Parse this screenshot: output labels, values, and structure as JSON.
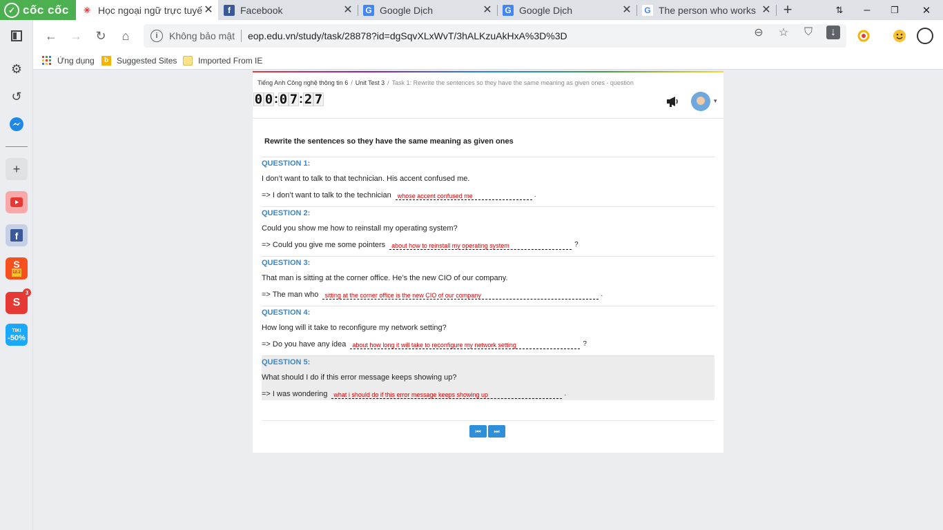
{
  "browser": {
    "brand": "cốc cốc",
    "tabs": [
      {
        "title": "Học ngoại ngữ trực tuyến",
        "favicon": "eop-icon"
      },
      {
        "title": "Facebook",
        "favicon": "facebook-icon"
      },
      {
        "title": "Google Dịch",
        "favicon": "google-translate-icon"
      },
      {
        "title": "Google Dịch",
        "favicon": "google-translate-icon"
      },
      {
        "title": "The person who works",
        "favicon": "google-icon"
      }
    ],
    "security_label": "Không bảo mật",
    "url": "eop.edu.vn/study/task/28878?id=dgSqvXLxWvT/3hALKzuAkHxA%3D%3D",
    "bookmarks": [
      "Ứng dụng",
      "Suggested Sites",
      "Imported From IE"
    ],
    "sidebar_badge": "3",
    "sidebar_shopee_label": "12.2",
    "sidebar_tiki_label": "TIKI",
    "sidebar_tiki_discount": "-50%"
  },
  "breadcrumb": {
    "course": "Tiếng Anh Công nghệ thông tin 6",
    "unit": "Unit Test 3",
    "task": "Task 1: Rewrite the sentences so they have the same meaning as given ones - question"
  },
  "timer": {
    "h1": "0",
    "h2": "0",
    "m1": "0",
    "m2": "7",
    "s1": "2",
    "s2": "7"
  },
  "instruction": "Rewrite the sentences so they have the same meaning as given ones",
  "questions": [
    {
      "title": "QUESTION 1:",
      "sentence": "I don’t want to talk to that technician. His accent confused me.",
      "prompt": "=> I don’t want to talk to the technician",
      "answer": "whose accent confused me",
      "ending": "."
    },
    {
      "title": "QUESTION 2:",
      "sentence": "Could you show me how to reinstall my operating system?",
      "prompt": "=> Could you give me some pointers",
      "answer": "about how to reinstall my operating system",
      "ending": "?"
    },
    {
      "title": "QUESTION 3:",
      "sentence": "That man is sitting at the corner office. He’s the new CIO of our company.",
      "prompt": "=> The man who",
      "answer": "sitting at the corner office is the new CIO of our company",
      "ending": "."
    },
    {
      "title": "QUESTION 4:",
      "sentence": "How long will it take to reconfigure my network setting?",
      "prompt": "=> Do you have any idea",
      "answer": "about how long it will take to reconfigure my network setting",
      "ending": "?"
    },
    {
      "title": "QUESTION 5:",
      "sentence": "What should I do if this error message keeps showing up?",
      "prompt": "=> I was wondering",
      "answer": "what i should do if this error message keeps showing up",
      "ending": "."
    }
  ]
}
